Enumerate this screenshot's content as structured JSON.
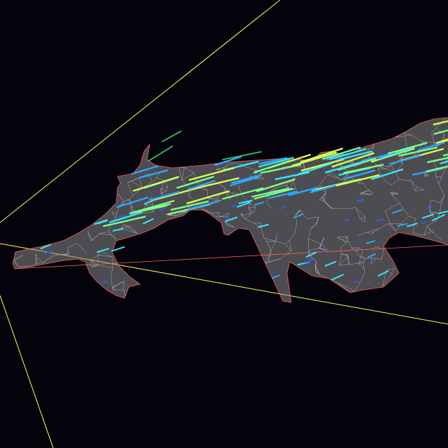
{
  "scene": {
    "background_color": "#04020a",
    "bounding_box_color": "#ffff55",
    "mesh_color": "#d8d8d8",
    "mesh_fill_color": "#8a8a8a",
    "boundary_color": "#ff6060",
    "vector_colormap": [
      "#2f5bff",
      "#2aa8ff",
      "#35e6ff",
      "#7dff8a",
      "#d9ff50",
      "#2ec95a"
    ],
    "description_free": true
  }
}
